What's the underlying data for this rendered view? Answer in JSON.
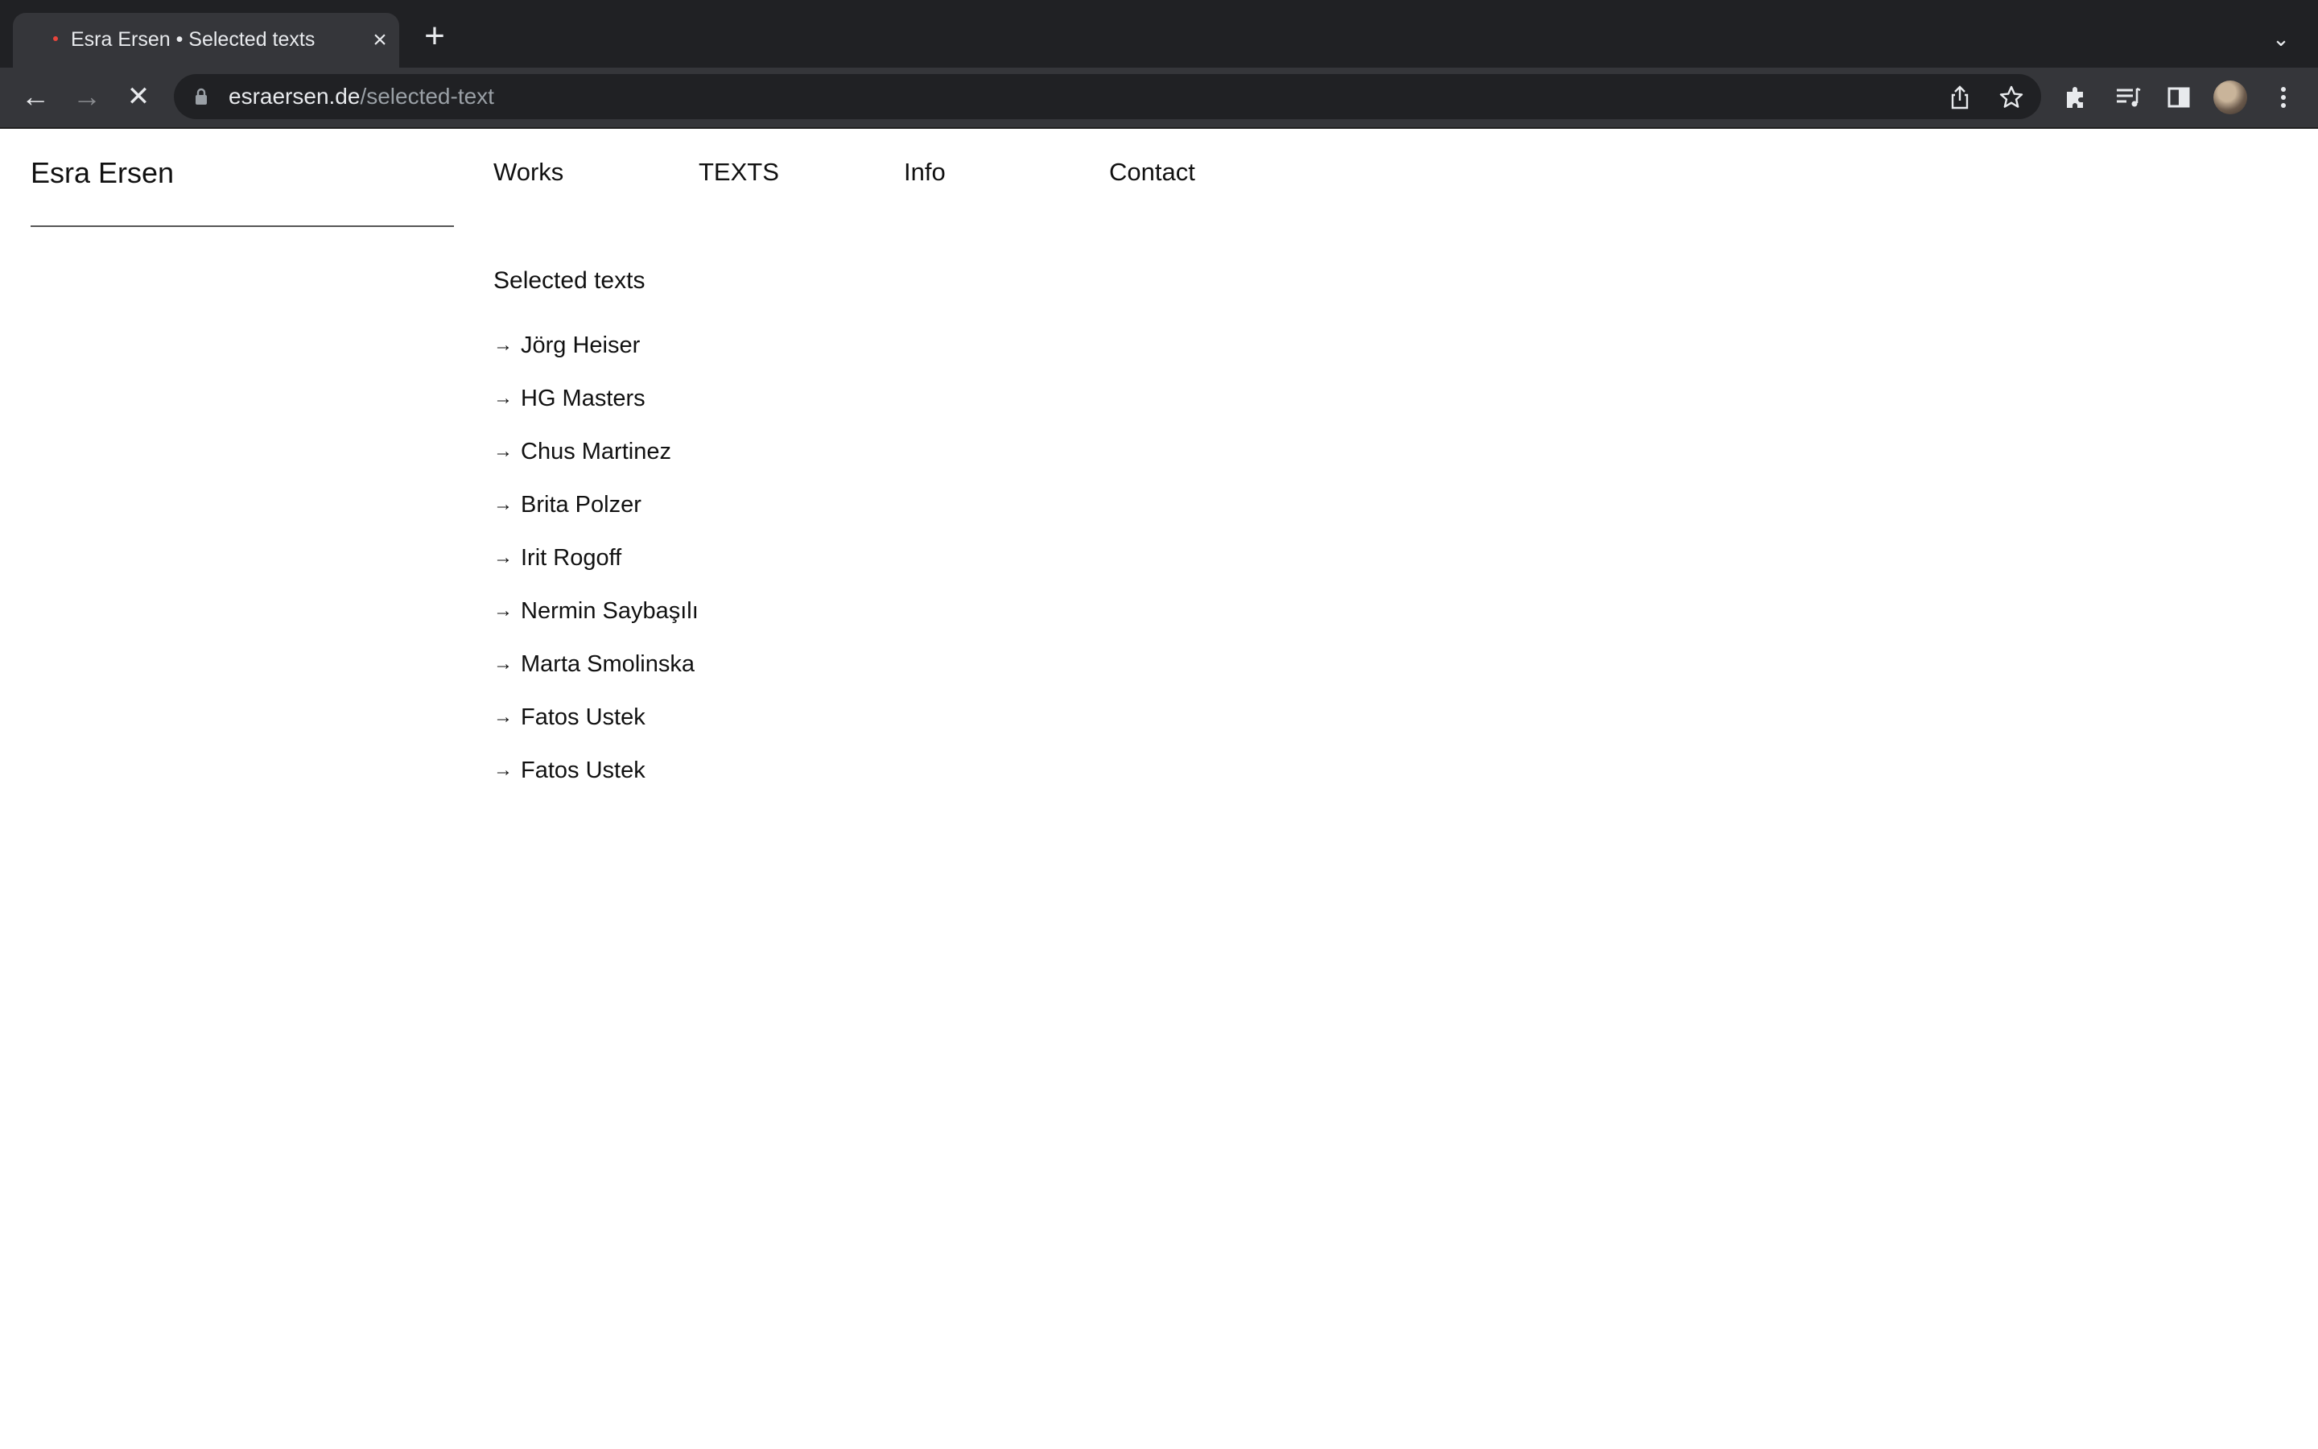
{
  "browser": {
    "tab_title": "Esra Ersen • Selected texts",
    "tab_close_glyph": "×",
    "new_tab_glyph": "+",
    "tab_list_glyph": "⌄",
    "url_host": "esraersen.de",
    "url_path": "/selected-text",
    "back_glyph": "←",
    "forward_glyph": "→",
    "stop_glyph": "✕",
    "icons": [
      "back-icon",
      "forward-icon",
      "stop-icon",
      "lock-icon",
      "share-icon",
      "star-icon",
      "extensions-icon",
      "reading-list-icon",
      "side-panel-icon",
      "profile-avatar",
      "menu-icon"
    ]
  },
  "site": {
    "title": "Esra Ersen",
    "nav": {
      "works": "Works",
      "texts": "TEXTS",
      "info": "Info",
      "contact": "Contact"
    },
    "section_heading": "Selected texts",
    "arrow_glyph": "→",
    "texts": [
      {
        "label": "Jörg Heiser"
      },
      {
        "label": "HG Masters"
      },
      {
        "label": "Chus Martinez"
      },
      {
        "label": "Brita Polzer"
      },
      {
        "label": "Irit Rogoff"
      },
      {
        "label": "Nermin Saybaşılı"
      },
      {
        "label": "Marta Smolinska"
      },
      {
        "label": "Fatos Ustek"
      },
      {
        "label": "Fatos Ustek"
      }
    ]
  },
  "colors": {
    "chrome_dark": "#202124",
    "chrome_toolbar": "#35363a",
    "page_bg": "#ffffff",
    "text": "#111111"
  }
}
